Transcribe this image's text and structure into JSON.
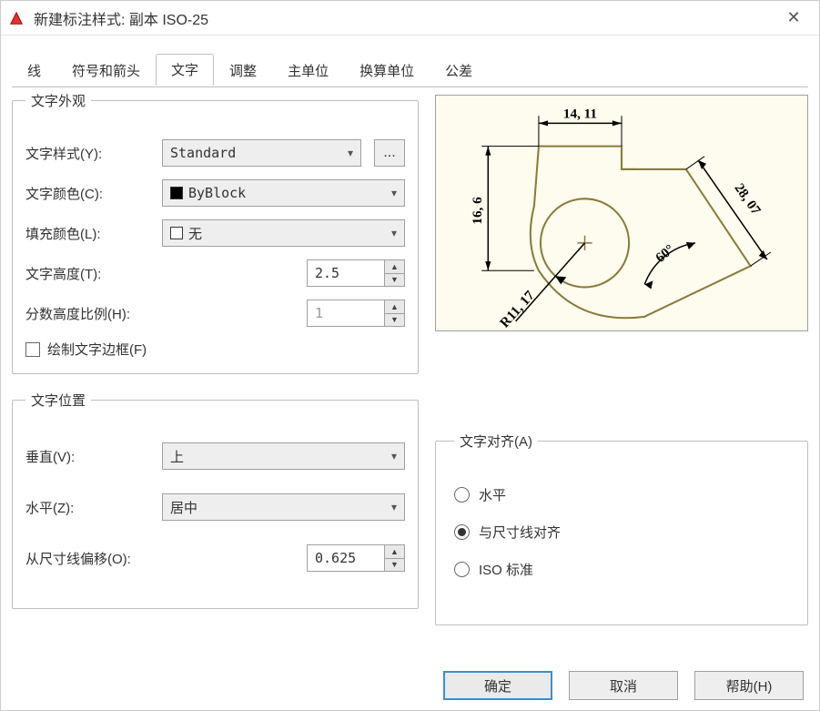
{
  "window": {
    "title": "新建标注样式: 副本 ISO-25"
  },
  "tabs": [
    "线",
    "符号和箭头",
    "文字",
    "调整",
    "主单位",
    "换算单位",
    "公差"
  ],
  "active_tab": "文字",
  "group_appearance": {
    "legend": "文字外观",
    "text_style_label": "文字样式(Y):",
    "text_style_value": "Standard",
    "ellipsis": "...",
    "text_color_label": "文字颜色(C):",
    "text_color_value": "ByBlock",
    "fill_color_label": "填充颜色(L):",
    "fill_color_value": "无",
    "text_height_label": "文字高度(T):",
    "text_height_value": "2.5",
    "fraction_scale_label": "分数高度比例(H):",
    "fraction_scale_value": "1",
    "draw_frame_label": "绘制文字边框(F)"
  },
  "group_placement": {
    "legend": "文字位置",
    "vertical_label": "垂直(V):",
    "vertical_value": "上",
    "horizontal_label": "水平(Z):",
    "horizontal_value": "居中",
    "offset_label": "从尺寸线偏移(O):",
    "offset_value": "0.625"
  },
  "group_alignment": {
    "legend": "文字对齐(A)",
    "opt_horizontal": "水平",
    "opt_aligned": "与尺寸线对齐",
    "opt_iso": "ISO 标准",
    "selected": "与尺寸线对齐"
  },
  "preview_dims": {
    "top": "14, 11",
    "left": "16, 6",
    "diag": "28, 07",
    "angle": "60°",
    "radius": "R11, 17"
  },
  "footer": {
    "ok": "确定",
    "cancel": "取消",
    "help": "帮助(H)"
  },
  "colors": {
    "preview_bg": "#fdfcee",
    "shape_stroke": "#8a7a3a"
  }
}
